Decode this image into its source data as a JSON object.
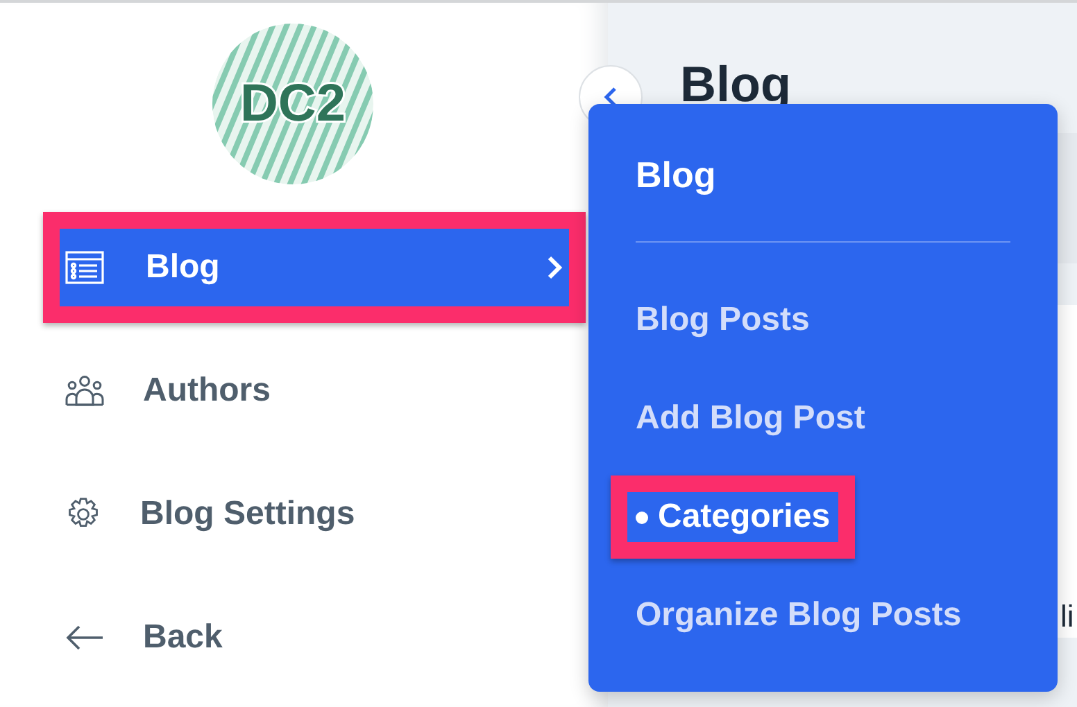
{
  "sidebar": {
    "logo": {
      "text": "DC2"
    },
    "items": [
      {
        "label": "Blog",
        "selected": true,
        "annotated": true
      },
      {
        "label": "Authors",
        "selected": false,
        "annotated": false
      },
      {
        "label": "Blog Settings",
        "selected": false,
        "annotated": false
      },
      {
        "label": "Back",
        "selected": false,
        "annotated": false
      }
    ]
  },
  "main": {
    "title": "Blog",
    "cut_text": "li"
  },
  "flyout": {
    "title": "Blog",
    "items": [
      {
        "label": "Blog Posts",
        "selected": false,
        "annotated": false
      },
      {
        "label": "Add Blog Post",
        "selected": false,
        "annotated": false
      },
      {
        "label": "Categories",
        "selected": true,
        "annotated": true
      },
      {
        "label": "Organize Blog Posts",
        "selected": false,
        "annotated": false
      }
    ]
  }
}
